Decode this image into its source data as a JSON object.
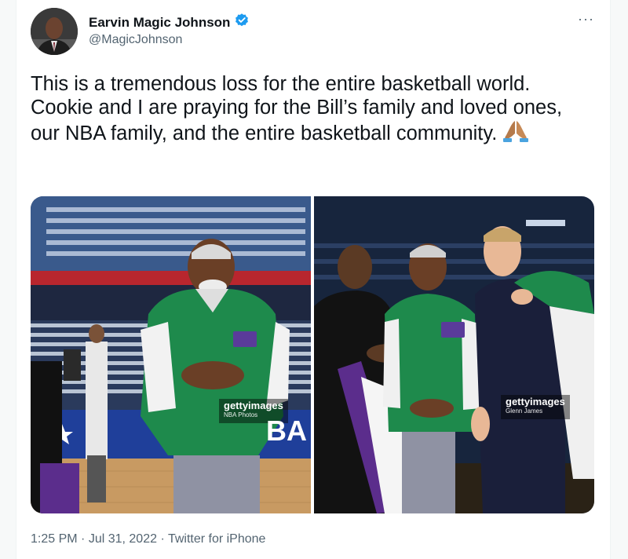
{
  "tweet": {
    "author_name": "Earvin Magic Johnson",
    "author_handle": "@MagicJohnson",
    "more_label": "···",
    "text": "This is a tremendous loss for the entire basketball world. Cookie and I are praying for the Bill’s family and loved ones, our NBA family, and the entire basketball community.",
    "emoji": "🙏",
    "verified_icon": "verified-badge-icon",
    "timestamp_time": "1:25 PM",
    "timestamp_date": "Jul 31, 2022",
    "source": "Twitter for iPhone",
    "separator": " · "
  },
  "media": [
    {
      "watermark_brand": "gettyimages",
      "watermark_credit": "NBA Photos",
      "banner_text": "BA"
    },
    {
      "watermark_brand": "gettyimages",
      "watermark_credit": "Glenn James"
    }
  ],
  "colors": {
    "verified": "#1d9bf0",
    "jacket_green": "#1e8a4c",
    "floor": "#c89a62",
    "muted_text": "#536471"
  }
}
